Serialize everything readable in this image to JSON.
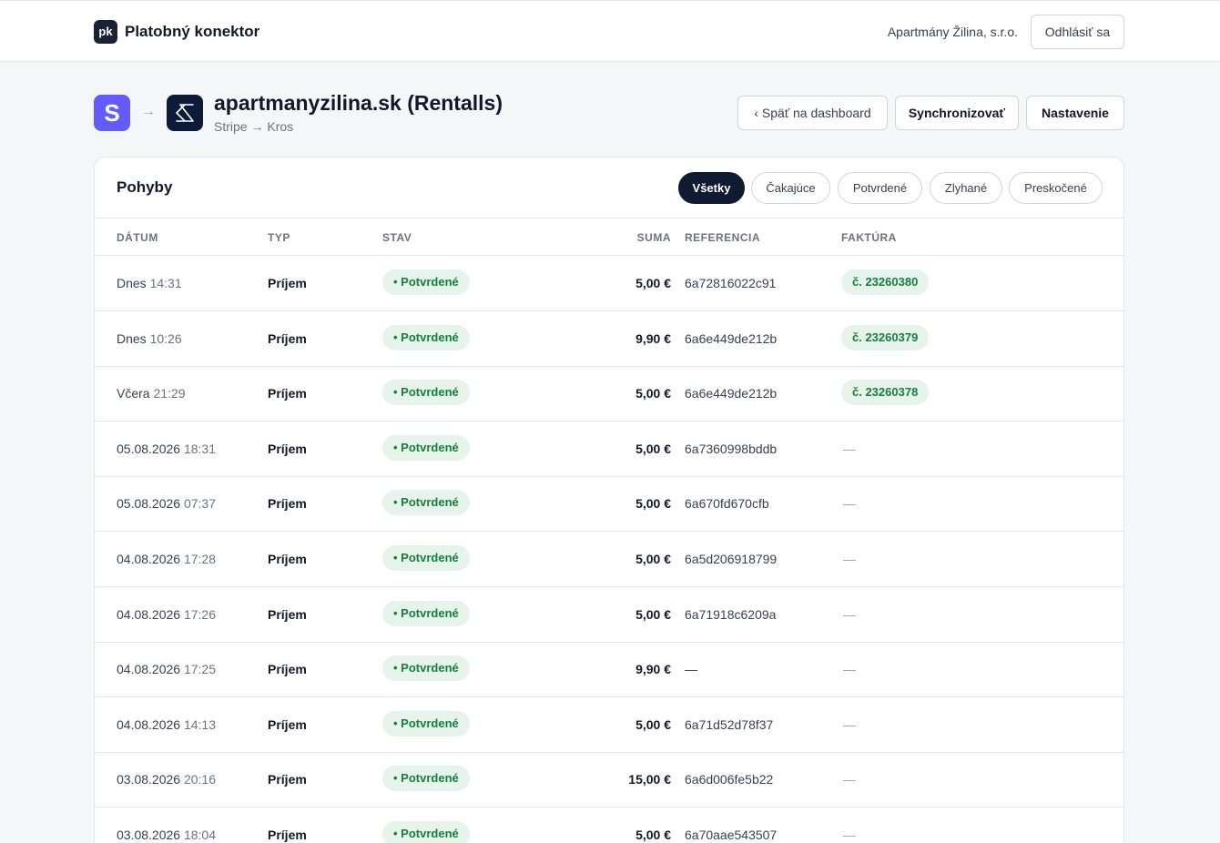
{
  "app": {
    "logo_text": "pk",
    "title": "Platobný konektor",
    "company": "Apartmány Žilina, s.r.o.",
    "logout_label": "Odhlásiť sa"
  },
  "connector": {
    "source_logo": "S",
    "arrow": "→",
    "title": "apartmanyzilina.sk (Rentalls)",
    "subtitle": "Stripe → Kros",
    "back_label": "‹ Späť na dashboard",
    "sync_label": "Synchronizovať",
    "settings_label": "Nastavenie"
  },
  "movements": {
    "title": "Pohyby",
    "filters": [
      "Všetky",
      "Čakajúce",
      "Potvrdené",
      "Zlyhané",
      "Preskočené"
    ],
    "active_filter": "Všetky",
    "columns": {
      "date": "DÁTUM",
      "type": "TYP",
      "status": "STAV",
      "amount": "SUMA",
      "reference": "REFERENCIA",
      "invoice": "FAKTÚRA"
    },
    "rows": [
      {
        "day": "Dnes",
        "time": "14:31",
        "type": "Príjem",
        "status": "• Potvrdené",
        "amount": "5,00 €",
        "reference": "6a72816022c91",
        "invoice": "č. 23260380"
      },
      {
        "day": "Dnes",
        "time": "10:26",
        "type": "Príjem",
        "status": "• Potvrdené",
        "amount": "9,90 €",
        "reference": "6a6e449de212b",
        "invoice": "č. 23260379"
      },
      {
        "day": "Včera",
        "time": "21:29",
        "type": "Príjem",
        "status": "• Potvrdené",
        "amount": "5,00 €",
        "reference": "6a6e449de212b",
        "invoice": "č. 23260378"
      },
      {
        "day": "05.08.2026",
        "time": "18:31",
        "type": "Príjem",
        "status": "• Potvrdené",
        "amount": "5,00 €",
        "reference": "6a7360998bddb",
        "invoice": "—"
      },
      {
        "day": "05.08.2026",
        "time": "07:37",
        "type": "Príjem",
        "status": "• Potvrdené",
        "amount": "5,00 €",
        "reference": "6a670fd670cfb",
        "invoice": "—"
      },
      {
        "day": "04.08.2026",
        "time": "17:28",
        "type": "Príjem",
        "status": "• Potvrdené",
        "amount": "5,00 €",
        "reference": "6a5d206918799",
        "invoice": "—"
      },
      {
        "day": "04.08.2026",
        "time": "17:26",
        "type": "Príjem",
        "status": "• Potvrdené",
        "amount": "5,00 €",
        "reference": "6a71918c6209a",
        "invoice": "—"
      },
      {
        "day": "04.08.2026",
        "time": "17:25",
        "type": "Príjem",
        "status": "• Potvrdené",
        "amount": "9,90 €",
        "reference": "—",
        "invoice": "—"
      },
      {
        "day": "04.08.2026",
        "time": "14:13",
        "type": "Príjem",
        "status": "• Potvrdené",
        "amount": "5,00 €",
        "reference": "6a71d52d78f37",
        "invoice": "—"
      },
      {
        "day": "03.08.2026",
        "time": "20:16",
        "type": "Príjem",
        "status": "• Potvrdené",
        "amount": "15,00 €",
        "reference": "6a6d006fe5b22",
        "invoice": "—"
      },
      {
        "day": "03.08.2026",
        "time": "18:04",
        "type": "Príjem",
        "status": "• Potvrdené",
        "amount": "5,00 €",
        "reference": "6a70aae543507",
        "invoice": "—"
      }
    ]
  },
  "colors": {
    "accent_dark": "#111a33",
    "stripe": "#635bff",
    "kros": "#0d1a3a",
    "success_bg": "#e6f4ec",
    "success_text": "#15803d"
  }
}
